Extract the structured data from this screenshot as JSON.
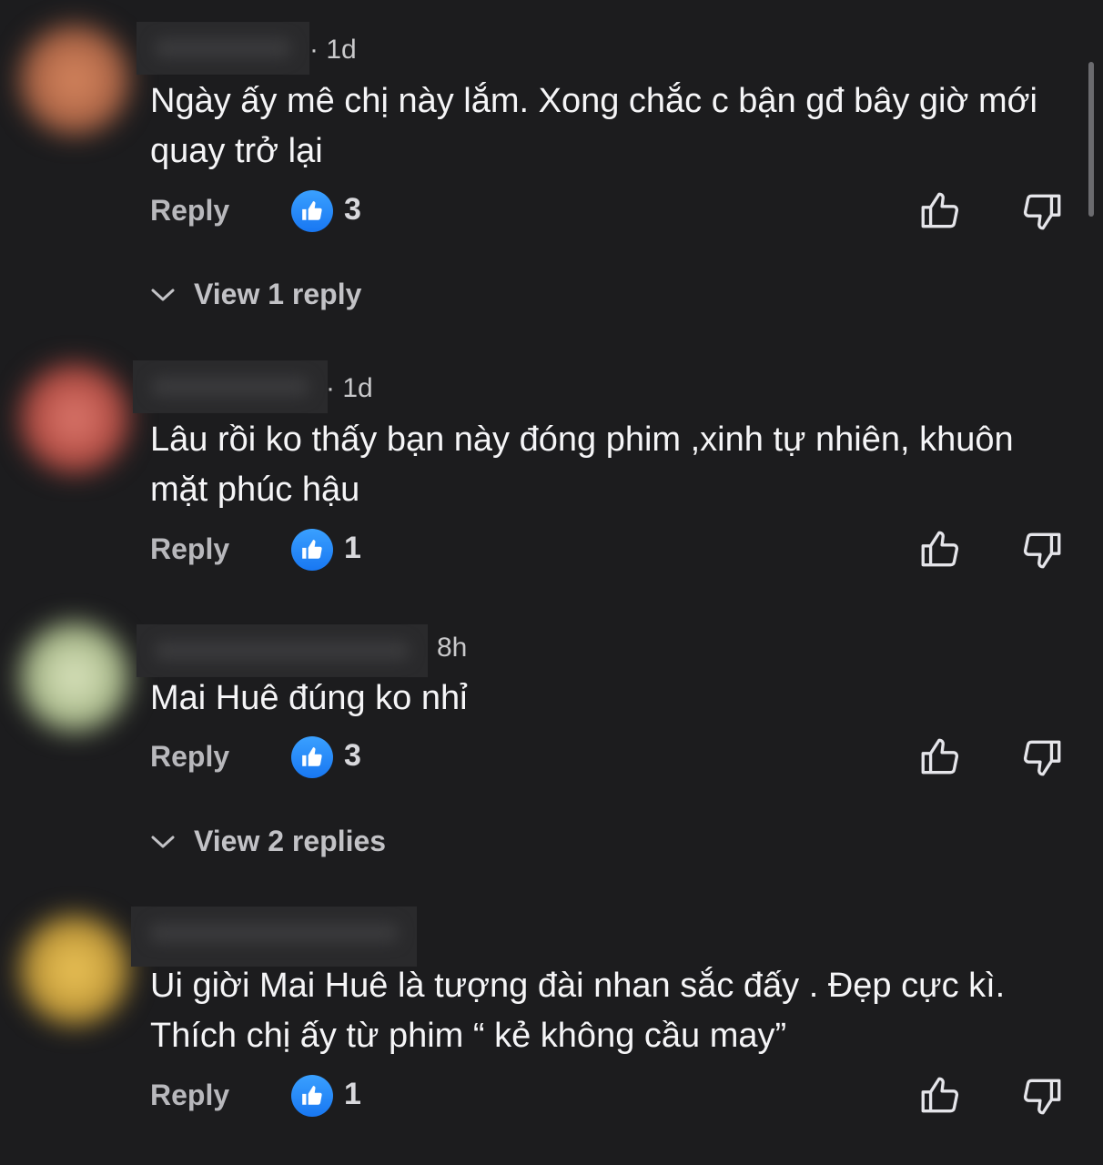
{
  "comments": [
    {
      "time": "· 1d",
      "text": "Ngày ấy mê chị này lắm. Xong chắc c bận gđ bây giờ mới quay trở lại",
      "reply_label": "Reply",
      "likes": "3",
      "view_replies": "View 1 reply",
      "avatar_color": "#c87a5a"
    },
    {
      "time": "· 1d",
      "text": "Lâu rồi ko thấy bạn này đóng phim ,xinh tự nhiên, khuôn mặt phúc hậu",
      "reply_label": "Reply",
      "likes": "1",
      "avatar_color": "#b8443a"
    },
    {
      "time": "8h",
      "text": "Mai Huê đúng ko nhỉ",
      "reply_label": "Reply",
      "likes": "3",
      "view_replies": "View 2 replies",
      "avatar_color": "#c9d6a8"
    },
    {
      "text": "Ui giời Mai Huê là tượng đài nhan sắc đấy . Đẹp cực kì. Thích chị ấy từ phim “ kẻ không cầu may”",
      "reply_label": "Reply",
      "likes": "1",
      "avatar_color": "#d9b04a"
    }
  ],
  "colors": {
    "background": "#1c1c1e",
    "like_badge": "#1877f2"
  },
  "icons": [
    "thumbs-up-filled-icon",
    "thumbs-up-outline-icon",
    "thumbs-down-outline-icon",
    "chevron-down-icon"
  ]
}
